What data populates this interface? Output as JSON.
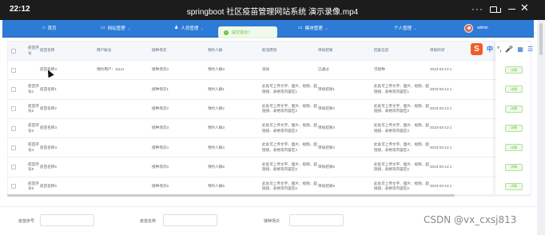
{
  "window": {
    "time": "22:12",
    "title": "springboot 社区疫苗管理网站系统 演示录像.mp4",
    "more": "···",
    "close": "✕"
  },
  "nav": {
    "items": [
      {
        "label": "首页",
        "icon": "home-icon",
        "glyph": "⌂",
        "caret": ""
      },
      {
        "label": "网站管理",
        "icon": "monitor-icon",
        "glyph": "▭",
        "caret": "⌄"
      },
      {
        "label": "人员管理",
        "icon": "user-icon",
        "glyph": "♟",
        "caret": "⌄"
      },
      {
        "label": "模块管理",
        "icon": "module-icon",
        "glyph": "▭",
        "caret": "⌄"
      },
      {
        "label": "个人管理",
        "icon": "profile-icon",
        "glyph": "",
        "caret": "⌄"
      }
    ],
    "user": "admin"
  },
  "toast": {
    "text": "提交成功！",
    "icon": "check-icon",
    "glyph": "✓"
  },
  "table": {
    "columns": [
      "疫苗序号",
      "疫苗名称",
      "用户账号",
      "接种场次",
      "预约人群",
      "取消原因",
      "审核结果",
      "回复信息",
      "审核时间"
    ],
    "rows": [
      {
        "seq": "",
        "name": "疫苗名称3",
        "account": "预约用户：11111",
        "session": "接种场次3",
        "crowd": "预约人群3",
        "reason": "测试",
        "result": "已通过",
        "reply": "可接种",
        "time": "2023-03-13 1",
        "action": "详情"
      },
      {
        "seq": "疫苗序号1",
        "name": "疫苗名称1",
        "account": "",
        "session": "接种场次1",
        "crowd": "预约人群1",
        "reason": "此处可上传文字、图片、视频、超链接、表格等内容区1",
        "result": "审核结果1",
        "reply": "此处可上传文字、图片、视频、超链接、表格等内容区1",
        "time": "2023-03-13 1",
        "action": "详情"
      },
      {
        "seq": "疫苗序号2",
        "name": "疫苗名称2",
        "account": "",
        "session": "接种场次2",
        "crowd": "预约人群2",
        "reason": "此处可上传文字、图片、视频、超链接、表格等内容区2",
        "result": "审核结果2",
        "reply": "此处可上传文字、图片、视频、超链接、表格等内容区2",
        "time": "2023-03-13 1",
        "action": "详情"
      },
      {
        "seq": "疫苗序号3",
        "name": "疫苗名称3",
        "account": "",
        "session": "接种场次3",
        "crowd": "预约人群3",
        "reason": "此处可上传文字、图片、视频、超链接、表格等内容区3",
        "result": "审核结果3",
        "reply": "此处可上传文字、图片、视频、超链接、表格等内容区3",
        "time": "2023-03-13 1",
        "action": "详情"
      },
      {
        "seq": "疫苗序号4",
        "name": "疫苗名称4",
        "account": "",
        "session": "接种场次4",
        "crowd": "预约人群4",
        "reason": "此处可上传文字、图片、视频、超链接、表格等内容区4",
        "result": "审核结果4",
        "reply": "此处可上传文字、图片、视频、超链接、表格等内容区4",
        "time": "2023-03-13 1",
        "action": "详情"
      },
      {
        "seq": "疫苗序号5",
        "name": "疫苗名称5",
        "account": "",
        "session": "接种场次5",
        "crowd": "预约人群5",
        "reason": "此处可上传文字、图片、视频、超链接、表格等内容区5",
        "result": "审核结果5",
        "reply": "此处可上传文字、图片、视频、超链接、表格等内容区5",
        "time": "2023-03-13 1",
        "action": "详情"
      },
      {
        "seq": "疫苗序号6",
        "name": "疫苗名称6",
        "account": "",
        "session": "接种场次6",
        "crowd": "预约人群6",
        "reason": "此处可上传文字、图片、视频、超链接、表格等内容区6",
        "result": "审核结果6",
        "reply": "此处可上传文字、图片、视频、超链接、表格等内容区6",
        "time": "2023-03-13 1",
        "action": "详情"
      }
    ]
  },
  "ime": {
    "logo": "S",
    "items": [
      "中",
      "°,",
      "🎤",
      "▦",
      "☰"
    ]
  },
  "filter": {
    "labels": [
      "疫苗序号",
      "疫苗名称",
      "接种场次"
    ]
  },
  "watermark": "CSDN @vx_cxsj813",
  "colors": {
    "nav": "#2d7bd6",
    "success": "#67c23a",
    "titlebar": "#1c1c1c"
  }
}
